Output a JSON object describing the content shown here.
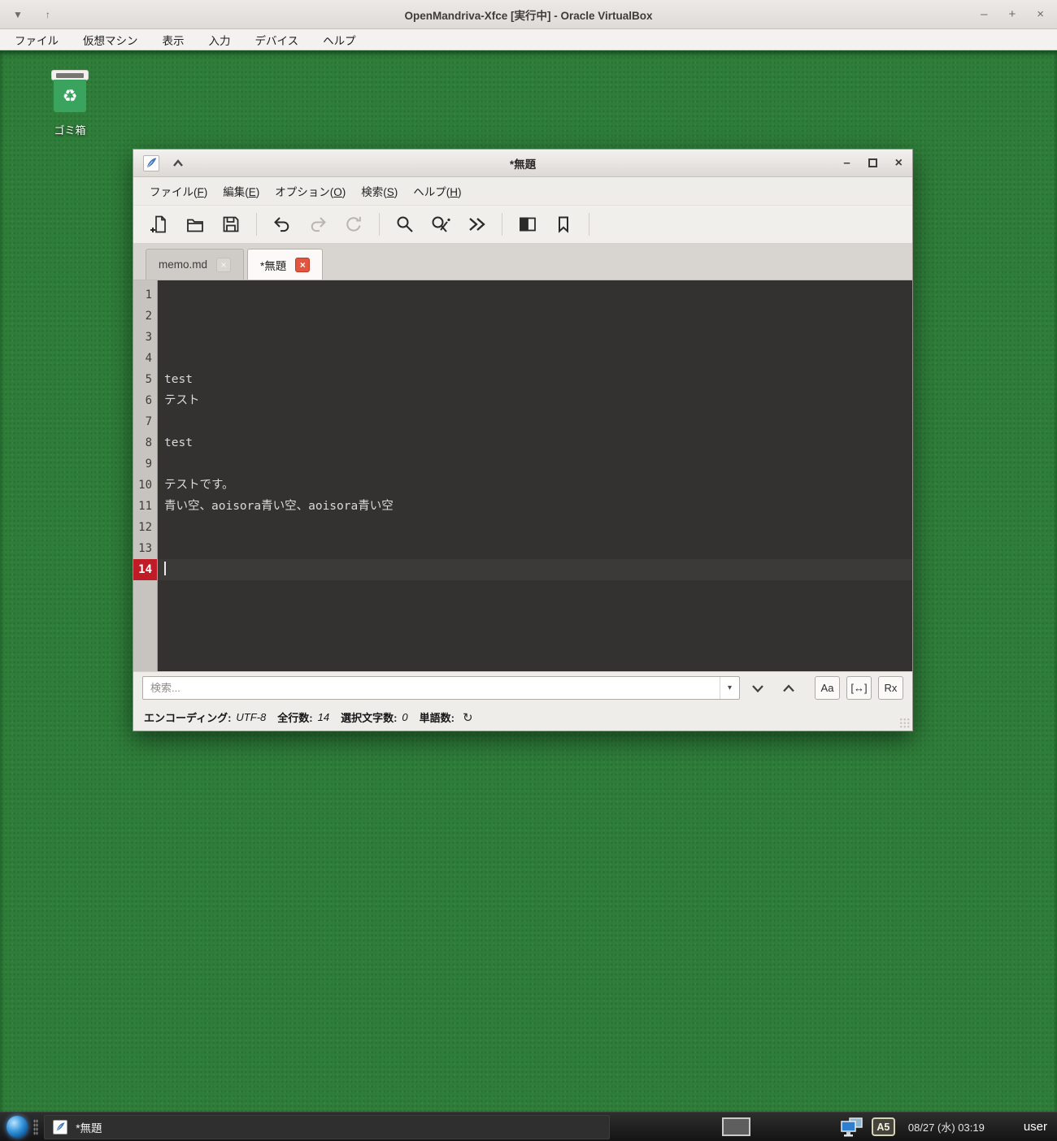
{
  "vbox": {
    "title": "OpenMandriva-Xfce [実行中] - Oracle VirtualBox",
    "menu_items": [
      "ファイル",
      "仮想マシン",
      "表示",
      "入力",
      "デバイス",
      "ヘルプ"
    ],
    "controls": {
      "menu_down": "▼",
      "front_up": "↑",
      "minimize": "–",
      "restore": "+",
      "close": "×"
    }
  },
  "desktop": {
    "trash_label": "ゴミ箱",
    "trash_glyph": "♻"
  },
  "editor": {
    "window_title": "*無題",
    "controls": {
      "minimize": "–",
      "close": "×"
    },
    "close_glyph": "×",
    "menu": [
      {
        "pre": "ファイル(",
        "key": "F",
        "post": ")"
      },
      {
        "pre": "編集(",
        "key": "E",
        "post": ")"
      },
      {
        "pre": "オプション(",
        "key": "O",
        "post": ")"
      },
      {
        "pre": "検索(",
        "key": "S",
        "post": ")"
      },
      {
        "pre": "ヘルプ(",
        "key": "H",
        "post": ")"
      }
    ],
    "toolbar_icons": [
      "new-file-icon",
      "open-folder-icon",
      "save-icon",
      "undo-icon",
      "redo-icon",
      "reload-icon",
      "search-icon",
      "search-replace-icon",
      "goto-icon",
      "side-pane-icon",
      "bookmark-icon"
    ],
    "tabs": [
      {
        "label": "memo.md",
        "active": false
      },
      {
        "label": "*無題",
        "active": true
      }
    ],
    "lines": [
      {
        "n": "1",
        "t": ""
      },
      {
        "n": "2",
        "t": ""
      },
      {
        "n": "3",
        "t": ""
      },
      {
        "n": "4",
        "t": ""
      },
      {
        "n": "5",
        "t": "test"
      },
      {
        "n": "6",
        "t": "テスト"
      },
      {
        "n": "7",
        "t": ""
      },
      {
        "n": "8",
        "t": "test"
      },
      {
        "n": "9",
        "t": ""
      },
      {
        "n": "10",
        "t": "テストです。"
      },
      {
        "n": "11",
        "t": "青い空、aoisora青い空、aoisora青い空"
      },
      {
        "n": "12",
        "t": ""
      },
      {
        "n": "13",
        "t": ""
      },
      {
        "n": "14",
        "t": ""
      }
    ],
    "search": {
      "placeholder": "検索...",
      "combo_arrow": "▾",
      "match_case": "Aa",
      "whole_word": "[↔]",
      "regex": "Rx"
    },
    "status": {
      "encoding_label": "エンコーディング:",
      "encoding": "UTF-8",
      "total_lines_label": "全行数:",
      "total_lines": "14",
      "selected_chars_label": "選択文字数:",
      "selected_chars": "0",
      "words_label": "単語数:",
      "refresh_icon": "↻"
    }
  },
  "taskbar": {
    "task_label": "*無題",
    "ime_label": "A5",
    "clock": "08/27 (水) 03:19",
    "user": "user"
  },
  "colors": {
    "desktop_green": "#2e7d39",
    "editor_background": "#333231",
    "current_line_number_bg": "#c01c28",
    "active_tab_close": "#e2553f",
    "openmandriva_blue": "#2b8fd8",
    "trash_green": "#3aa45f"
  }
}
